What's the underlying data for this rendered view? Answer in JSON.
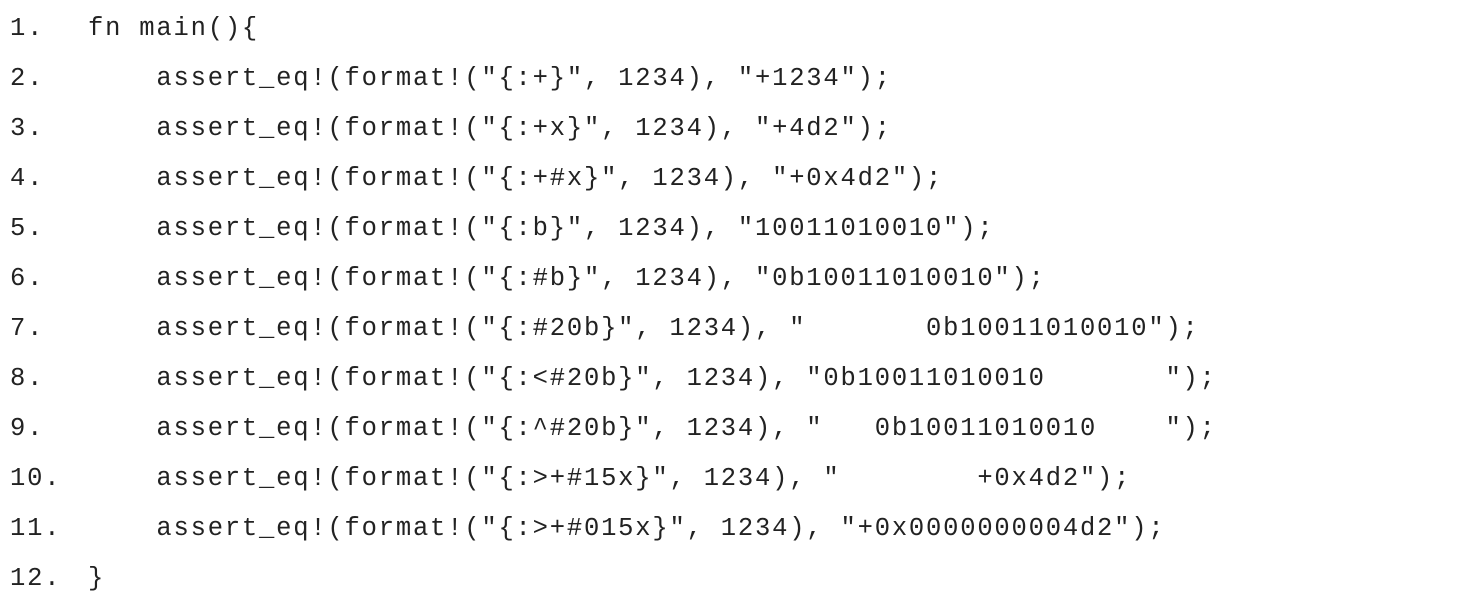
{
  "code": {
    "lines": [
      {
        "number": "1.",
        "text": "fn main(){"
      },
      {
        "number": "2.",
        "text": "    assert_eq!(format!(\"{:+}\", 1234), \"+1234\");"
      },
      {
        "number": "3.",
        "text": "    assert_eq!(format!(\"{:+x}\", 1234), \"+4d2\");"
      },
      {
        "number": "4.",
        "text": "    assert_eq!(format!(\"{:+#x}\", 1234), \"+0x4d2\");"
      },
      {
        "number": "5.",
        "text": "    assert_eq!(format!(\"{:b}\", 1234), \"10011010010\");"
      },
      {
        "number": "6.",
        "text": "    assert_eq!(format!(\"{:#b}\", 1234), \"0b10011010010\");"
      },
      {
        "number": "7.",
        "text": "    assert_eq!(format!(\"{:#20b}\", 1234), \"       0b10011010010\");"
      },
      {
        "number": "8.",
        "text": "    assert_eq!(format!(\"{:<#20b}\", 1234), \"0b10011010010       \");"
      },
      {
        "number": "9.",
        "text": "    assert_eq!(format!(\"{:^#20b}\", 1234), \"   0b10011010010    \");"
      },
      {
        "number": "10.",
        "text": "    assert_eq!(format!(\"{:>+#15x}\", 1234), \"        +0x4d2\");"
      },
      {
        "number": "11.",
        "text": "    assert_eq!(format!(\"{:>+#015x}\", 1234), \"+0x0000000004d2\");"
      },
      {
        "number": "12.",
        "text": "}"
      }
    ]
  }
}
